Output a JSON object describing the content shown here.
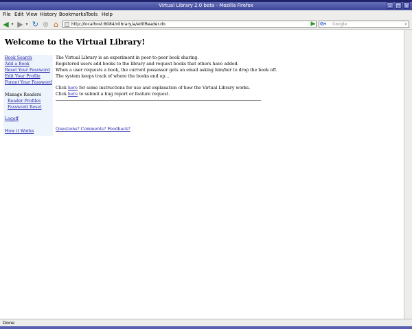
{
  "window": {
    "title": "Virtual Library 2.0 beta - Mozilla Firefox"
  },
  "menu": {
    "items": [
      "File",
      "Edit",
      "View",
      "History",
      "Bookmarks",
      "Tools",
      "Help"
    ]
  },
  "toolbar": {
    "url": "http://localhost:8084/vlibrary/a/editReader.do",
    "search_placeholder": "Google"
  },
  "page": {
    "heading": "Welcome to the Virtual Library!",
    "sidebar": {
      "links": [
        "Book Search",
        "Add a Book",
        "Reset Your Password",
        "Edit Your Profile",
        "Forgot Your Password"
      ],
      "manage_heading": "Manage Readers",
      "manage_links": [
        "Reader Profiles",
        "Password Reset"
      ],
      "logoff": "Logoff",
      "how_it_works": "How it Works"
    },
    "intro": [
      "The Virtual Library is an experiment in peer-to-peer book sharing.",
      "Registered users add books to the library and request books that others have added.",
      "When a user requests a book, the current possessor gets an email asking him/her to drop the book off.",
      "The system keeps track of where the books end up..."
    ],
    "click_label": "Click",
    "here_label": "here",
    "instructions_text": "for some instructions for use and explanation of how the Virtual Library works.",
    "bug_text": "to submit a bug report or feature request.",
    "feedback_link": "Questions? Comments? Feedback?"
  },
  "status": {
    "text": "Done"
  }
}
